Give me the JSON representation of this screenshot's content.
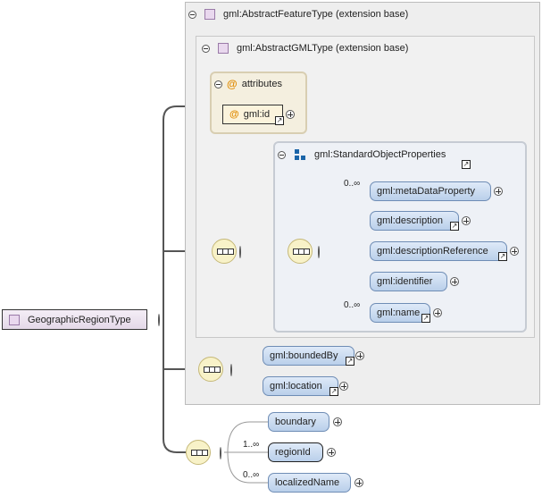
{
  "root": {
    "label": "GeographicRegionType"
  },
  "extension_outer": {
    "label": "gml:AbstractFeatureType (extension base)"
  },
  "extension_inner": {
    "label": "gml:AbstractGMLType (extension base)"
  },
  "attributes_group": {
    "label": "attributes",
    "items": [
      {
        "label": "gml:id"
      }
    ]
  },
  "standard_object_properties": {
    "label": "gml:StandardObjectProperties",
    "elements": [
      {
        "label": "gml:metaDataProperty",
        "cardinality": "0..∞"
      },
      {
        "label": "gml:description"
      },
      {
        "label": "gml:descriptionReference"
      },
      {
        "label": "gml:identifier"
      },
      {
        "label": "gml:name",
        "cardinality": "0..∞"
      }
    ]
  },
  "feature_sequence": {
    "elements": [
      {
        "label": "gml:boundedBy"
      },
      {
        "label": "gml:location"
      }
    ]
  },
  "region_sequence": {
    "elements": [
      {
        "label": "boundary"
      },
      {
        "label": "regionId",
        "cardinality": "1..∞"
      },
      {
        "label": "localizedName",
        "cardinality": "0..∞"
      }
    ]
  },
  "colors": {
    "element_fill": "#c7d8ef",
    "attribute_accent": "#e08a00",
    "type_icon": "#e9d8ee",
    "sequence_fill": "#f8f2c8"
  }
}
